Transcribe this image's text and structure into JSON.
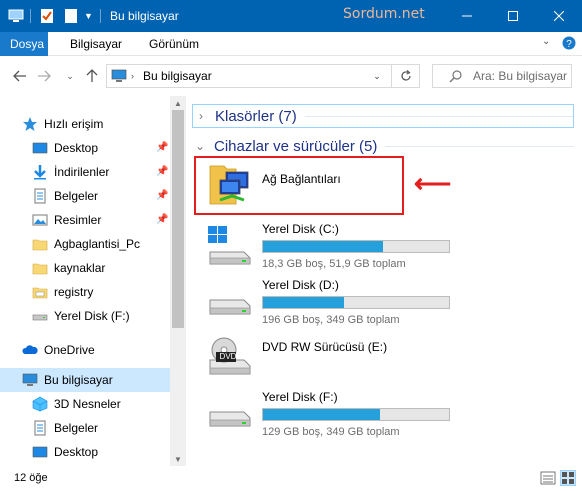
{
  "window": {
    "title": "Bu bilgisayar",
    "watermark": "Sordum.net",
    "accent": "#0063b1"
  },
  "ribbon": {
    "tabs": [
      "Dosya",
      "Bilgisayar",
      "Görünüm"
    ]
  },
  "address": {
    "path": "Bu bilgisayar",
    "search_placeholder": "Ara: Bu bilgisayar"
  },
  "nav": {
    "quick_access": "Hızlı erişim",
    "items": [
      {
        "label": "Desktop",
        "icon": "desktop-icon",
        "pinned": true
      },
      {
        "label": "İndirilenler",
        "icon": "downloads-icon",
        "pinned": true
      },
      {
        "label": "Belgeler",
        "icon": "documents-icon",
        "pinned": true
      },
      {
        "label": "Resimler",
        "icon": "pictures-icon",
        "pinned": true
      },
      {
        "label": "Agbaglantisi_Pc",
        "icon": "folder-icon",
        "pinned": false
      },
      {
        "label": "kaynaklar",
        "icon": "folder-icon",
        "pinned": false
      },
      {
        "label": "registry",
        "icon": "registry-folder-icon",
        "pinned": false
      },
      {
        "label": "Yerel Disk (F:)",
        "icon": "drive-icon",
        "pinned": false
      }
    ],
    "onedrive": "OneDrive",
    "this_pc": "Bu bilgisayar",
    "pc_items": [
      {
        "label": "3D Nesneler",
        "icon": "3d-objects-icon"
      },
      {
        "label": "Belgeler",
        "icon": "documents-icon"
      },
      {
        "label": "Desktop",
        "icon": "desktop-icon"
      }
    ]
  },
  "content": {
    "folders_group": "Klasörler (7)",
    "devices_group": "Cihazlar ve sürücüler (5)",
    "network": {
      "name": "Ağ Bağlantıları"
    },
    "drives": [
      {
        "name": "Yerel Disk (C:)",
        "info": "18,3 GB boş, 51,9 GB toplam",
        "used_fraction": 0.647,
        "icon": "windows-drive-icon"
      },
      {
        "name": "Yerel Disk (D:)",
        "info": "196 GB boş, 349 GB toplam",
        "used_fraction": 0.438,
        "icon": "drive-icon"
      },
      {
        "name": "DVD RW Sürücüsü (E:)",
        "info": "",
        "icon": "dvd-drive-icon"
      },
      {
        "name": "Yerel Disk (F:)",
        "info": "129 GB boş, 349 GB toplam",
        "used_fraction": 0.63,
        "icon": "drive-icon"
      }
    ],
    "dvd_badge": "DVD"
  },
  "status": {
    "count": "12 öğe"
  }
}
